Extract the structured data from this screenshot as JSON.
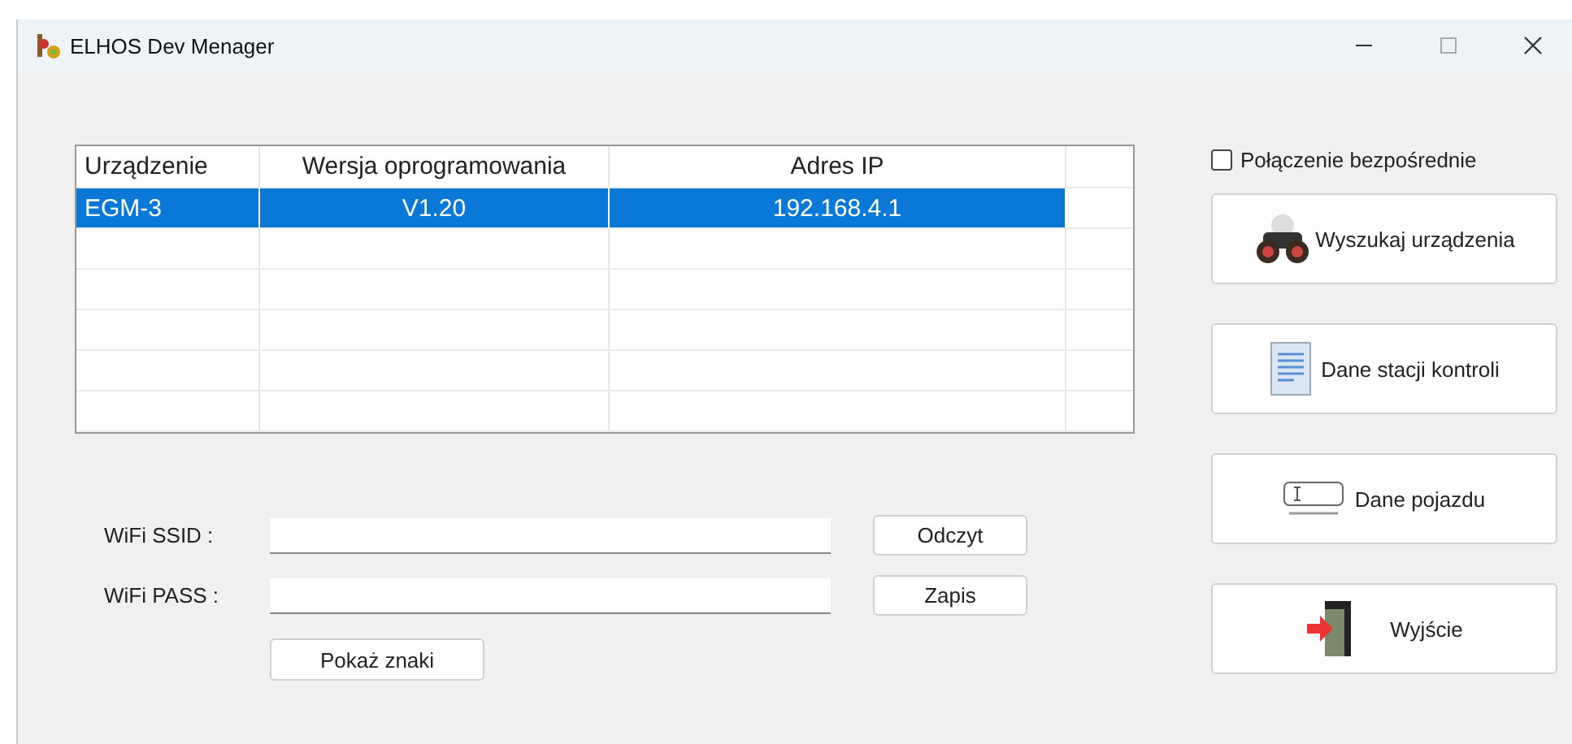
{
  "window": {
    "title": "ELHOS Dev Menager"
  },
  "table": {
    "columns": [
      "Urządzenie",
      "Wersja oprogramowania",
      "Adres IP"
    ],
    "rows": [
      {
        "cells": [
          "EGM-3",
          "V1.20",
          "192.168.4.1"
        ],
        "selected": true
      }
    ]
  },
  "direct_connection": {
    "label": "Połączenie bezpośrednie",
    "checked": false
  },
  "wifi": {
    "fields": [
      {
        "label": "WiFi SSID :",
        "button": "Odczyt"
      },
      {
        "label": "WiFi PASS :",
        "button": "Zapis"
      }
    ],
    "show_button": "Pokaż znaki"
  },
  "actions": [
    {
      "label": "Wyszukaj urządzenia",
      "kind": "search"
    },
    {
      "label": "Dane stacji kontroli",
      "kind": "document"
    },
    {
      "label": "Dane pojazdu",
      "kind": "vehicle"
    },
    {
      "label": "Wyjście",
      "kind": "exit"
    }
  ]
}
